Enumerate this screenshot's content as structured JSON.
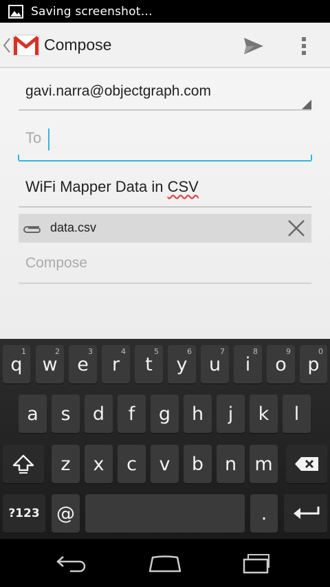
{
  "status_bar": {
    "notification_text": "Saving screenshot…"
  },
  "action_bar": {
    "title": "Compose",
    "icons": [
      "gmail-logo",
      "send-icon",
      "overflow-icon"
    ]
  },
  "compose": {
    "from": "gavi.narra@objectgraph.com",
    "to_placeholder": "To",
    "subject": "WiFi Mapper Data in ",
    "subject_misspelled": "CSV",
    "attachment_name": "data.csv",
    "body_placeholder": "Compose"
  },
  "colors": {
    "accent": "#33b5e5",
    "gmail_red": "#d93025"
  },
  "keyboard": {
    "row1": [
      {
        "label": "q",
        "hint": "1"
      },
      {
        "label": "w",
        "hint": "2"
      },
      {
        "label": "e",
        "hint": "3"
      },
      {
        "label": "r",
        "hint": "4"
      },
      {
        "label": "t",
        "hint": "5"
      },
      {
        "label": "y",
        "hint": "6"
      },
      {
        "label": "u",
        "hint": "7"
      },
      {
        "label": "i",
        "hint": "8"
      },
      {
        "label": "o",
        "hint": "9"
      },
      {
        "label": "p",
        "hint": "0"
      }
    ],
    "row2": [
      "a",
      "s",
      "d",
      "f",
      "g",
      "h",
      "j",
      "k",
      "l"
    ],
    "row3": [
      "z",
      "x",
      "c",
      "v",
      "b",
      "n",
      "m"
    ],
    "symbols_label": "?123",
    "at_label": "@",
    "period_label": "."
  }
}
